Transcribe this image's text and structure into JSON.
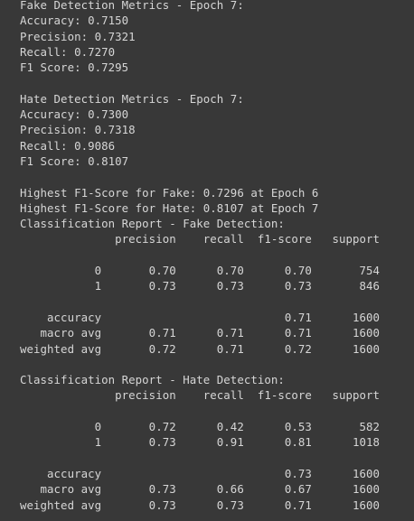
{
  "output": {
    "lines": [
      "Fake Detection Metrics - Epoch 7:",
      "Accuracy: 0.7150",
      "Precision: 0.7321",
      "Recall: 0.7270",
      "F1 Score: 0.7295",
      "",
      "Hate Detection Metrics - Epoch 7:",
      "Accuracy: 0.7300",
      "Precision: 0.7318",
      "Recall: 0.9086",
      "F1 Score: 0.8107",
      "",
      "Highest F1-Score for Fake: 0.7296 at Epoch 6",
      "Highest F1-Score for Hate: 0.8107 at Epoch 7",
      "Classification Report - Fake Detection:",
      "              precision    recall  f1-score   support",
      "",
      "           0       0.70      0.70      0.70       754",
      "           1       0.73      0.73      0.73       846",
      "",
      "    accuracy                           0.71      1600",
      "   macro avg       0.71      0.71      0.71      1600",
      "weighted avg       0.72      0.71      0.72      1600",
      "",
      "Classification Report - Hate Detection:",
      "              precision    recall  f1-score   support",
      "",
      "           0       0.72      0.42      0.53       582",
      "           1       0.73      0.91      0.81      1018",
      "",
      "    accuracy                           0.73      1600",
      "   macro avg       0.73      0.66      0.67      1600",
      "weighted avg       0.73      0.73      0.71      1600"
    ]
  }
}
